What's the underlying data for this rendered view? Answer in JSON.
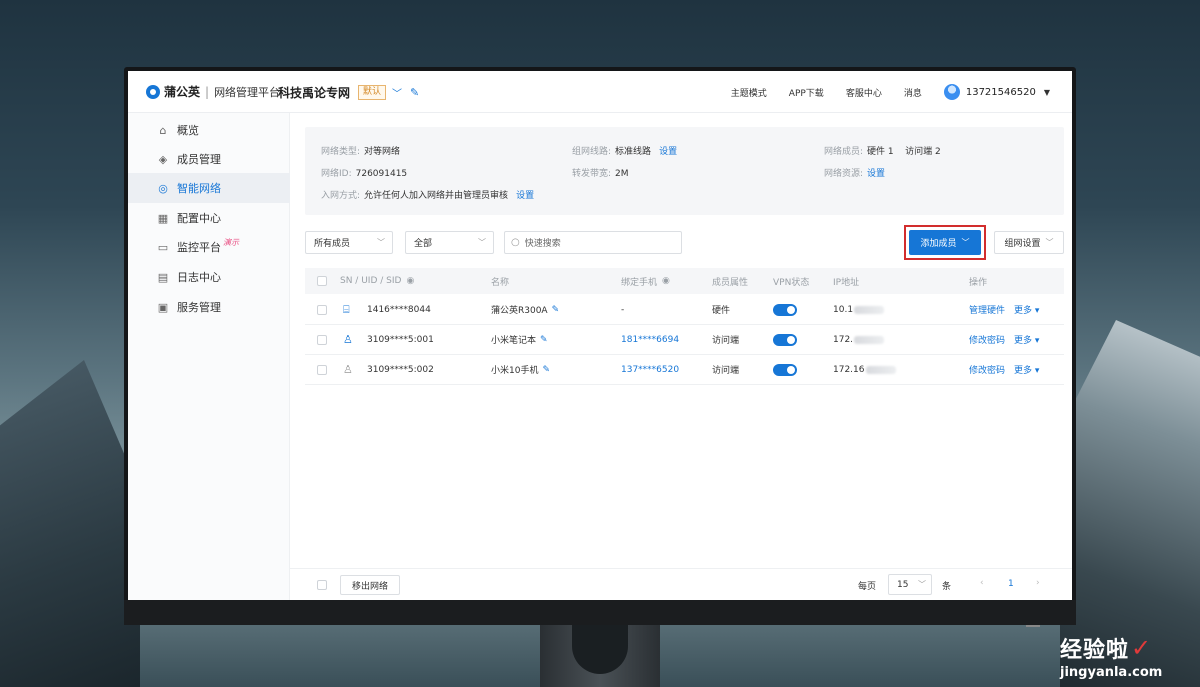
{
  "header": {
    "brand": "蒲公英",
    "platform": "网络管理平台",
    "network_name": "科技禹论专网",
    "default_badge": "默认",
    "menu": [
      "主题模式",
      "APP下载",
      "客服中心",
      "消息"
    ],
    "account": "13721546520"
  },
  "sidebar": {
    "items": [
      {
        "label": "概览",
        "icon": "home-icon"
      },
      {
        "label": "成员管理",
        "icon": "layers-icon"
      },
      {
        "label": "智能网络",
        "icon": "network-icon",
        "active": true
      },
      {
        "label": "配置中心",
        "icon": "grid-icon"
      },
      {
        "label": "监控平台",
        "icon": "monitor-icon",
        "tag": "演示"
      },
      {
        "label": "日志中心",
        "icon": "log-icon"
      },
      {
        "label": "服务管理",
        "icon": "service-icon"
      }
    ]
  },
  "info": {
    "net_type_label": "网络类型:",
    "net_type": "对等网络",
    "net_id_label": "网络ID:",
    "net_id": "726091415",
    "join_label": "入网方式:",
    "join": "允许任何人加入网络并由管理员审核",
    "join_link": "设置",
    "route_label": "组网线路:",
    "route": "标准线路",
    "route_link": "设置",
    "bandwidth_label": "转发带宽:",
    "bandwidth": "2M",
    "members_label": "网络成员:",
    "members": "硬件 1    访问端 2",
    "resources_label": "网络资源:",
    "resources_link": "设置"
  },
  "filters": {
    "member_filter": "所有成员",
    "scope_filter": "全部",
    "search_placeholder": "快速搜索",
    "add_member": "添加成员",
    "net_settings": "组网设置"
  },
  "table": {
    "headers": [
      "SN / UID / SID",
      "名称",
      "绑定手机",
      "成员属性",
      "VPN状态",
      "IP地址",
      "操作"
    ],
    "rows": [
      {
        "id": "1416****8044",
        "name": "蒲公英R300A",
        "phone": "-",
        "attr": "硬件",
        "ip": "10.1",
        "action": "管理硬件",
        "more": "更多",
        "icon": "router-icon"
      },
      {
        "id": "3109****5:001",
        "name": "小米笔记本",
        "phone": "181****6694",
        "attr": "访问端",
        "ip": "172.",
        "action": "修改密码",
        "more": "更多",
        "icon": "user-icon"
      },
      {
        "id": "3109****5:002",
        "name": "小米10手机",
        "phone": "137****6520",
        "attr": "访问端",
        "ip": "172.16",
        "action": "修改密码",
        "more": "更多",
        "icon": "user-icon"
      }
    ]
  },
  "footer": {
    "remove": "移出网络",
    "per_page_label": "每页",
    "per_page": "15",
    "unit": "条",
    "page": "1"
  },
  "watermark": {
    "cn": "经验啦",
    "en": "jingyanla.com"
  },
  "colors": {
    "accent": "#1676d6",
    "highlight_border": "#d22d2d",
    "demo_tag": "#e84a7f"
  }
}
